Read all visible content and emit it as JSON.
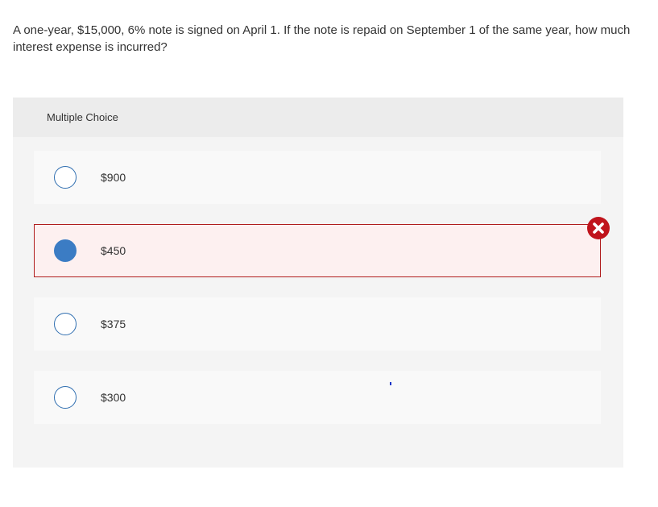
{
  "question": {
    "text": "A one-year, $15,000, 6% note is signed on April 1. If the note is repaid on September 1 of the same year, how much interest expense is incurred?"
  },
  "multiple_choice": {
    "header": "Multiple Choice",
    "options": [
      {
        "label": "$900",
        "selected": false
      },
      {
        "label": "$450",
        "selected": true,
        "status": "incorrect"
      },
      {
        "label": "$375",
        "selected": false
      },
      {
        "label": "$300",
        "selected": false
      }
    ]
  },
  "icons": {
    "incorrect_marker": "x-circle-icon"
  },
  "colors": {
    "radio_accent": "#3b7cc4",
    "incorrect_border": "#b01c1c",
    "incorrect_background": "#fdf0f0",
    "incorrect_icon": "#c0141c"
  }
}
